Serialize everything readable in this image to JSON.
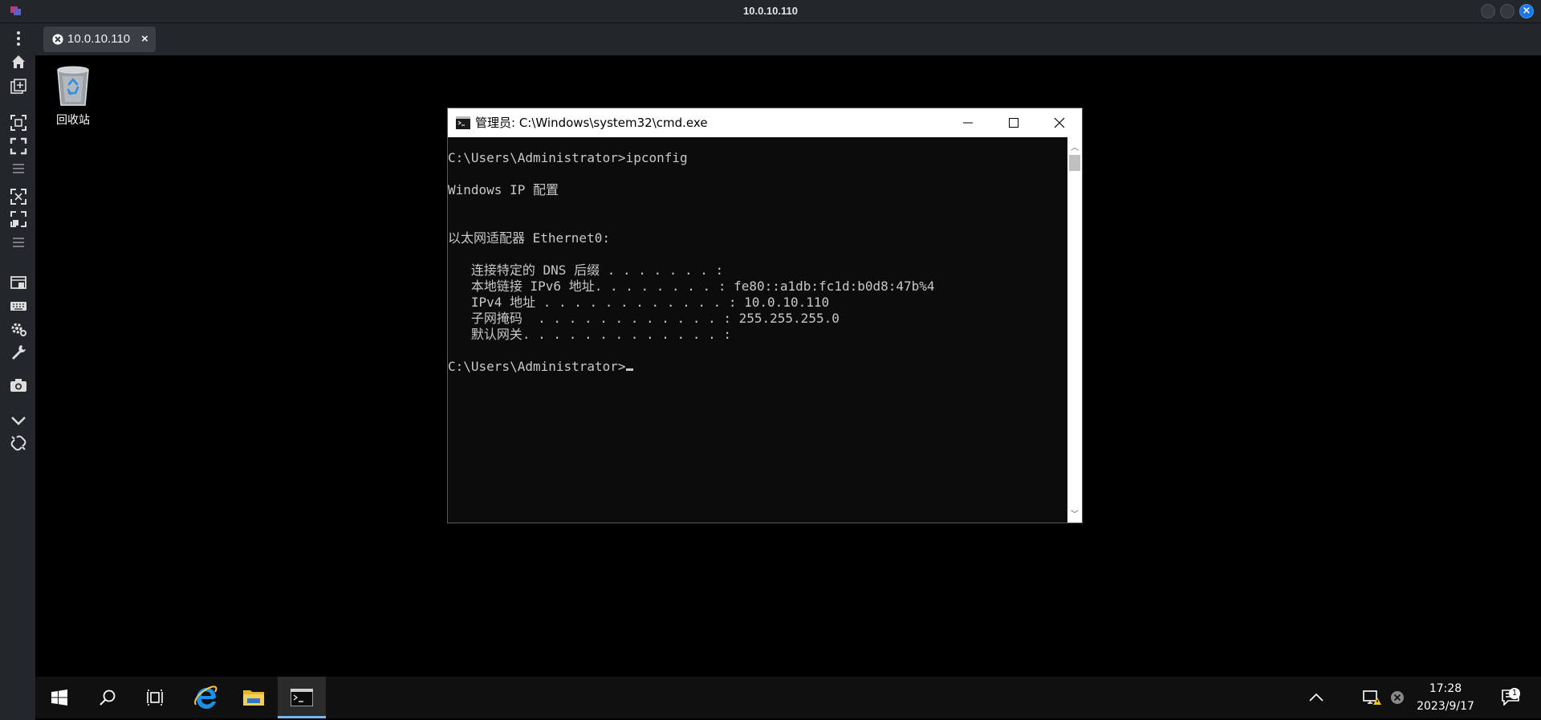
{
  "window": {
    "title": "10.0.10.110",
    "close_glyph": "×"
  },
  "tab": {
    "label": "10.0.10.110",
    "close_glyph": "×"
  },
  "sidebar": {
    "icons": [
      "more-vertical-icon",
      "home-icon",
      "new-session-icon",
      "fit-screen-icon",
      "fullscreen-icon",
      "menu-icon",
      "scale-icon",
      "resize-icon",
      "menu-icon",
      "display-icon",
      "keyboard-icon",
      "settings-icon",
      "tools-icon",
      "screenshot-icon",
      "collapse-icon",
      "disconnect-icon"
    ]
  },
  "desktop": {
    "recycle_bin_label": "回收站"
  },
  "cmd": {
    "title": "管理员: C:\\Windows\\system32\\cmd.exe",
    "lines": [
      "C:\\Users\\Administrator>ipconfig",
      "",
      "Windows IP 配置",
      "",
      "",
      "以太网适配器 Ethernet0:",
      "",
      "   连接特定的 DNS 后缀 . . . . . . . :",
      "   本地链接 IPv6 地址. . . . . . . . : fe80::a1db:fc1d:b0d8:47b%4",
      "   IPv4 地址 . . . . . . . . . . . . : 10.0.10.110",
      "   子网掩码  . . . . . . . . . . . . : 255.255.255.0",
      "   默认网关. . . . . . . . . . . . . :",
      "",
      "C:\\Users\\Administrator>"
    ]
  },
  "taskbar": {
    "time": "17:28",
    "date": "2023/9/17",
    "notification_count": "1",
    "accent_color": "#76b9ed"
  },
  "colors": {
    "window_chrome": "#23262b",
    "close_button": "#1877e8",
    "console_text": "#c8c8c8"
  }
}
